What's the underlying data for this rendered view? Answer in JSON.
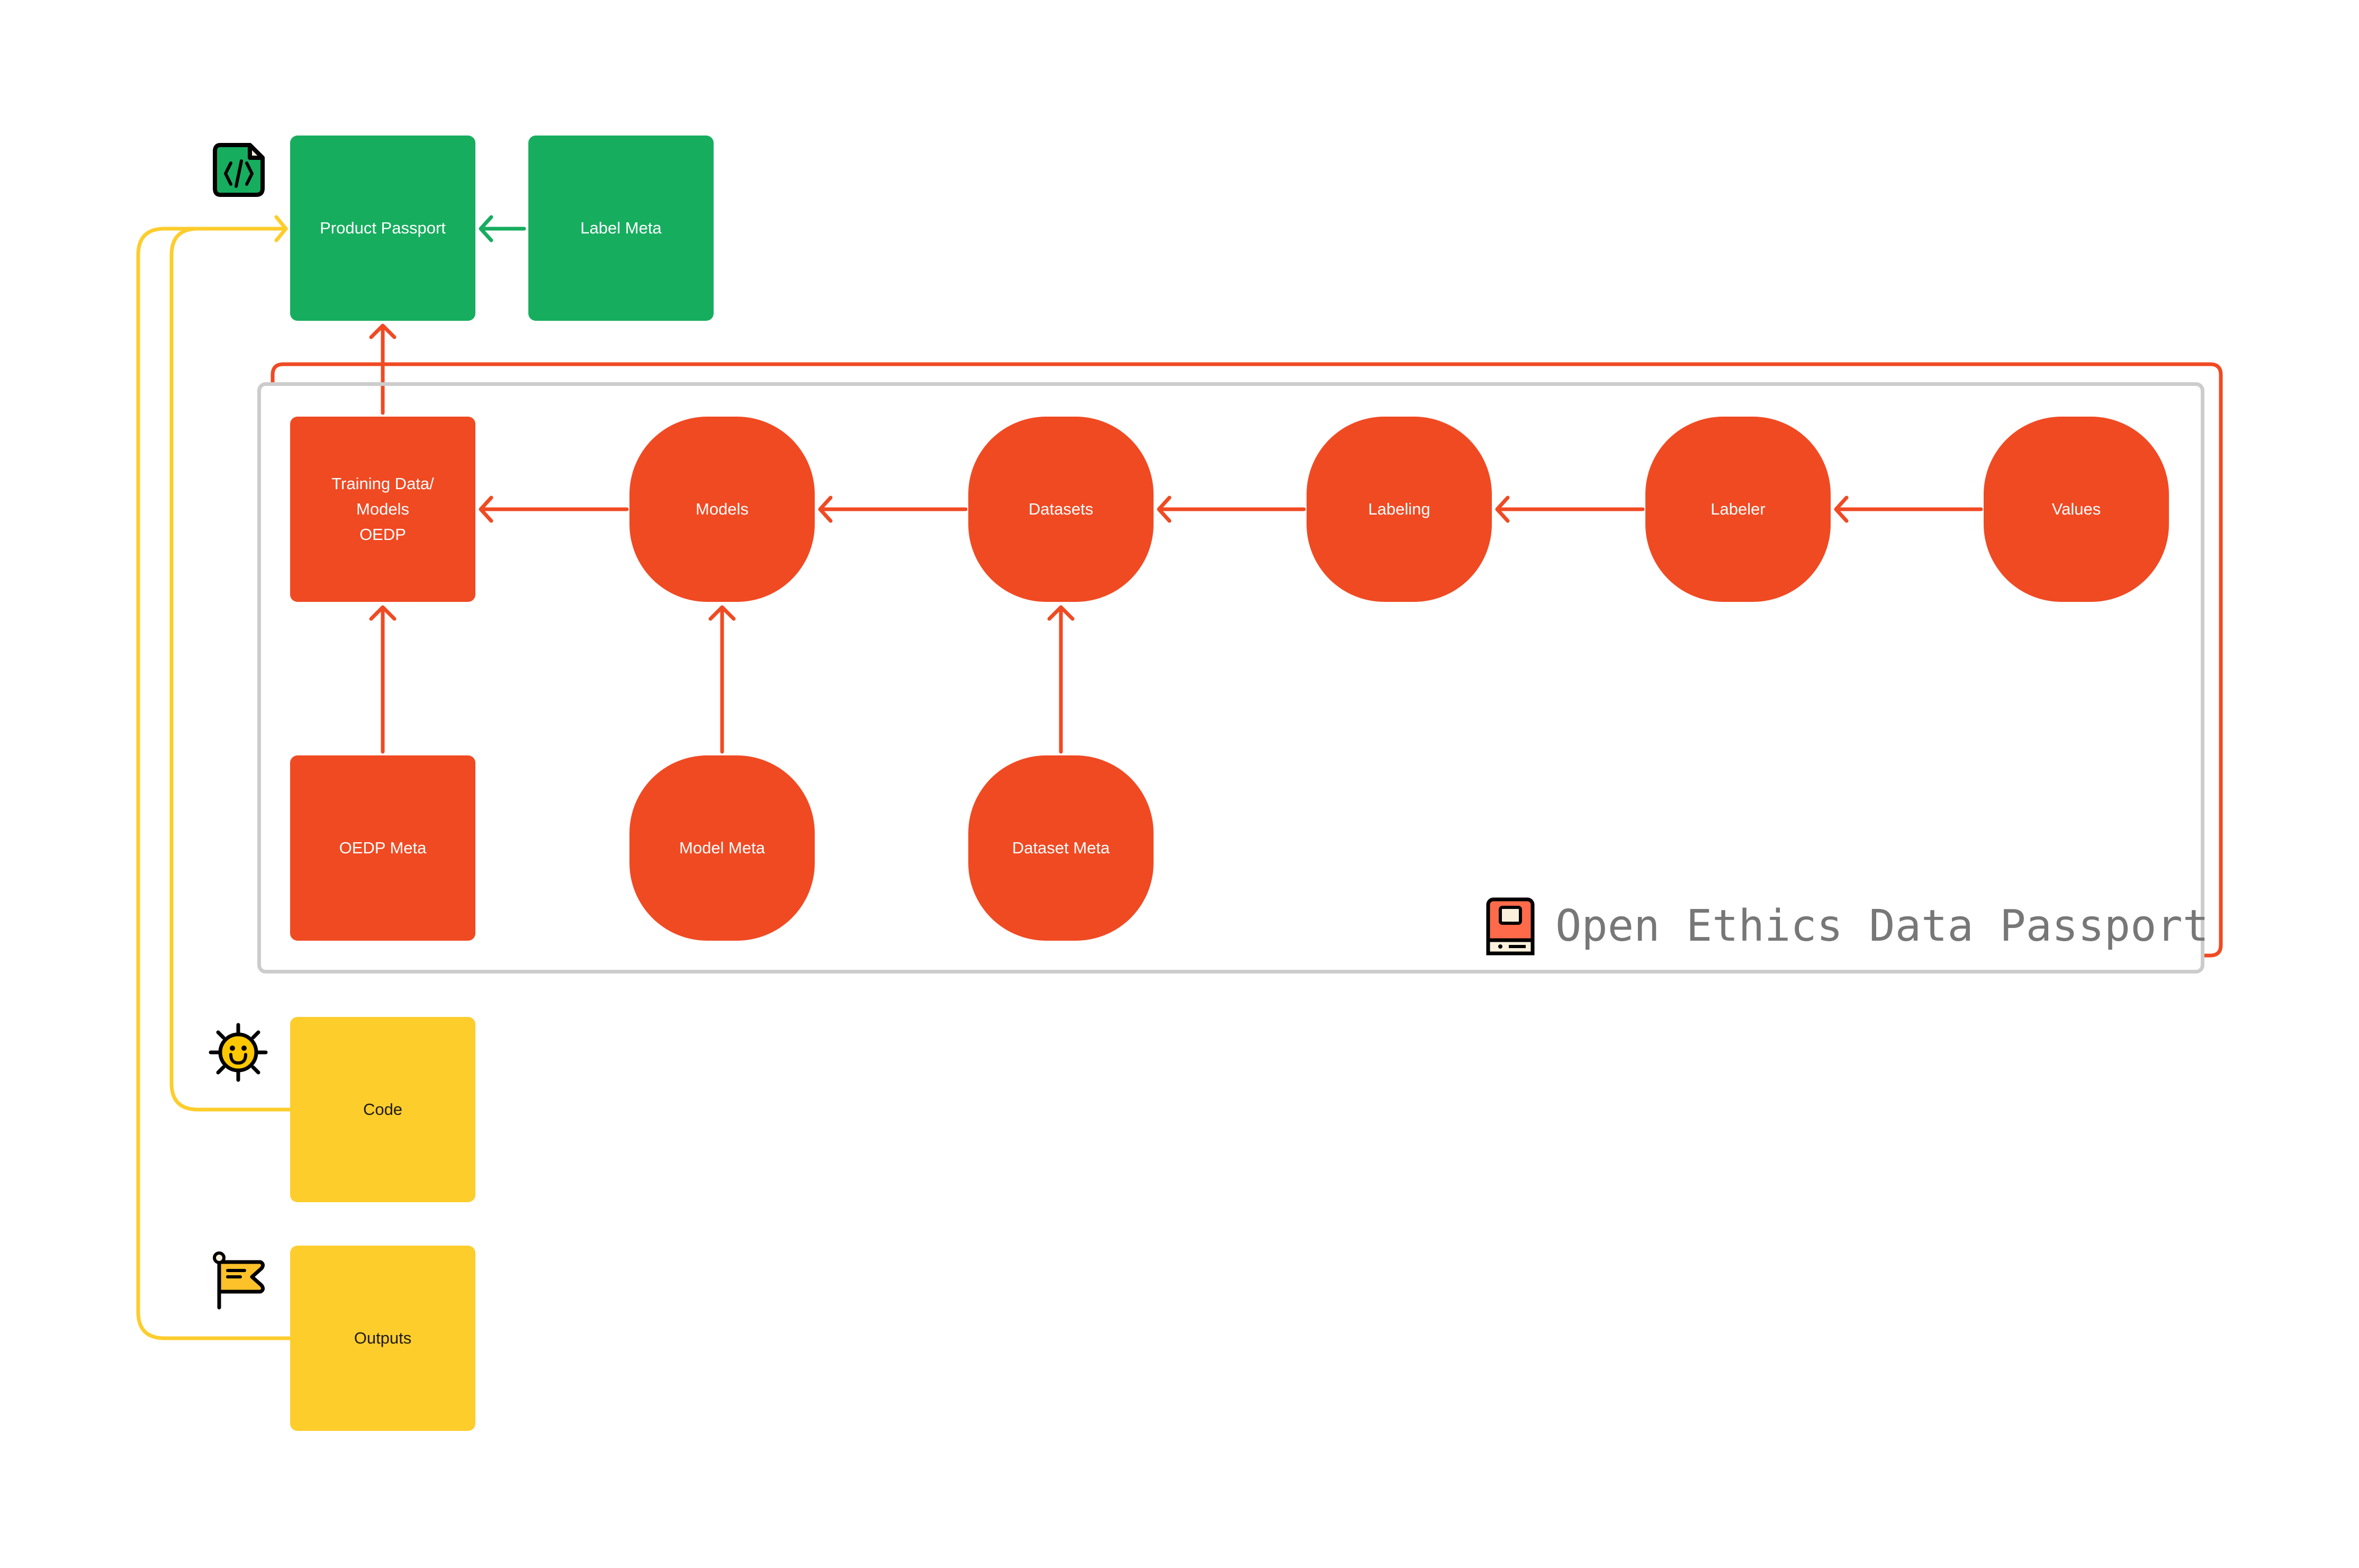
{
  "diagram": {
    "title": "Open Ethics Data Passport",
    "colors": {
      "green": "#17ad5f",
      "red": "#f04a23",
      "yellow": "#fdcd2c",
      "container_border": "#cccccc",
      "title_text": "#777777"
    },
    "nodes": {
      "product_passport": "Product Passport",
      "label_meta": "Label Meta",
      "training_data": "Training Data/\nModels\nOEDP",
      "models": "Models",
      "datasets": "Datasets",
      "labeling": "Labeling",
      "labeler": "Labeler",
      "values": "Values",
      "oedp_meta": "OEDP Meta",
      "model_meta": "Model Meta",
      "dataset_meta": "Dataset Meta",
      "code": "Code",
      "outputs": "Outputs"
    },
    "edges": [
      {
        "from": "Label Meta",
        "to": "Product Passport"
      },
      {
        "from": "Training Data/Models OEDP",
        "to": "Product Passport"
      },
      {
        "from": "Code",
        "to": "Product Passport"
      },
      {
        "from": "Outputs",
        "to": "Product Passport"
      },
      {
        "from": "Models",
        "to": "Training Data/Models OEDP"
      },
      {
        "from": "Datasets",
        "to": "Models"
      },
      {
        "from": "Labeling",
        "to": "Datasets"
      },
      {
        "from": "Labeler",
        "to": "Labeling"
      },
      {
        "from": "Values",
        "to": "Labeler"
      },
      {
        "from": "OEDP Meta",
        "to": "Training Data/Models OEDP"
      },
      {
        "from": "Model Meta",
        "to": "Models"
      },
      {
        "from": "Dataset Meta",
        "to": "Datasets"
      }
    ],
    "icons": {
      "product_passport": "code-file-icon",
      "code": "sun-smile-icon",
      "outputs": "flag-icon",
      "title": "book-icon"
    }
  }
}
